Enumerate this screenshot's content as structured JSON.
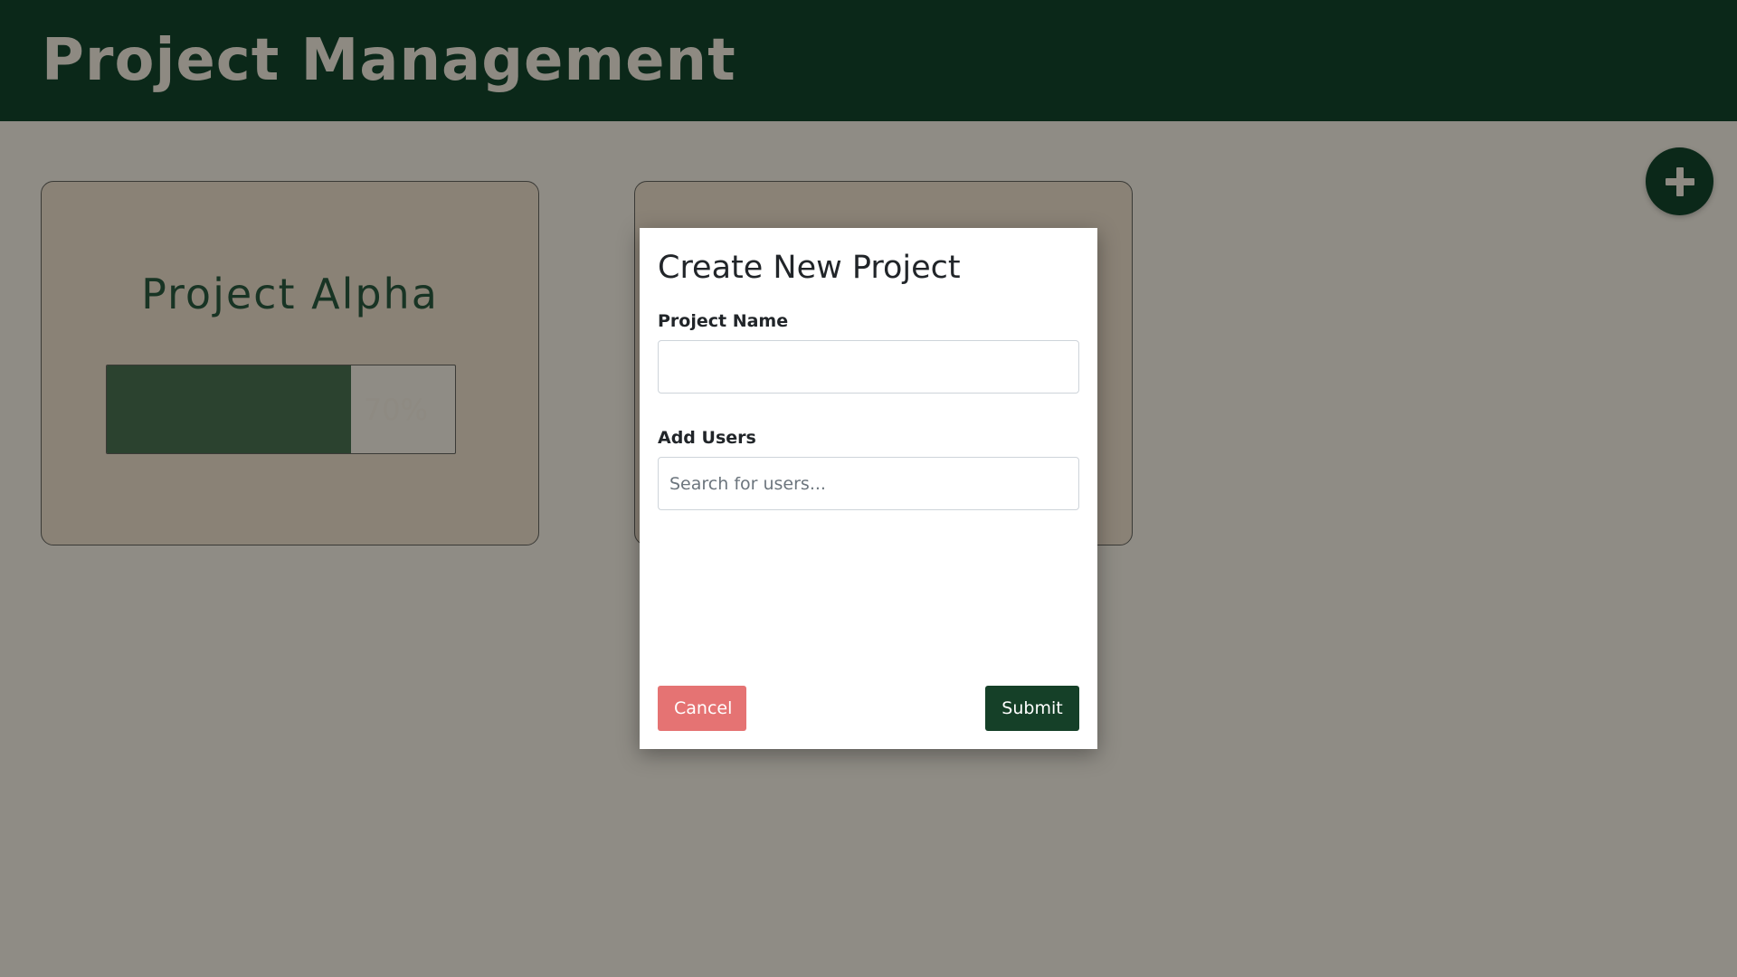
{
  "header": {
    "title": "Project Management"
  },
  "fab": {
    "icon": "plus-icon"
  },
  "projects": [
    {
      "name": "Project Alpha",
      "progress": 70,
      "progress_label": "70%"
    }
  ],
  "modal": {
    "title": "Create New Project",
    "project_name_label": "Project Name",
    "project_name_value": "",
    "add_users_label": "Add Users",
    "users_search_placeholder": "Search for users...",
    "cancel_label": "Cancel",
    "submit_label": "Submit"
  },
  "colors": {
    "header_bg": "#0b2819",
    "page_overlay": "#8f8c85",
    "progress_fill": "#2b422f",
    "cancel_button": "#e57373",
    "submit_button": "#154028"
  }
}
